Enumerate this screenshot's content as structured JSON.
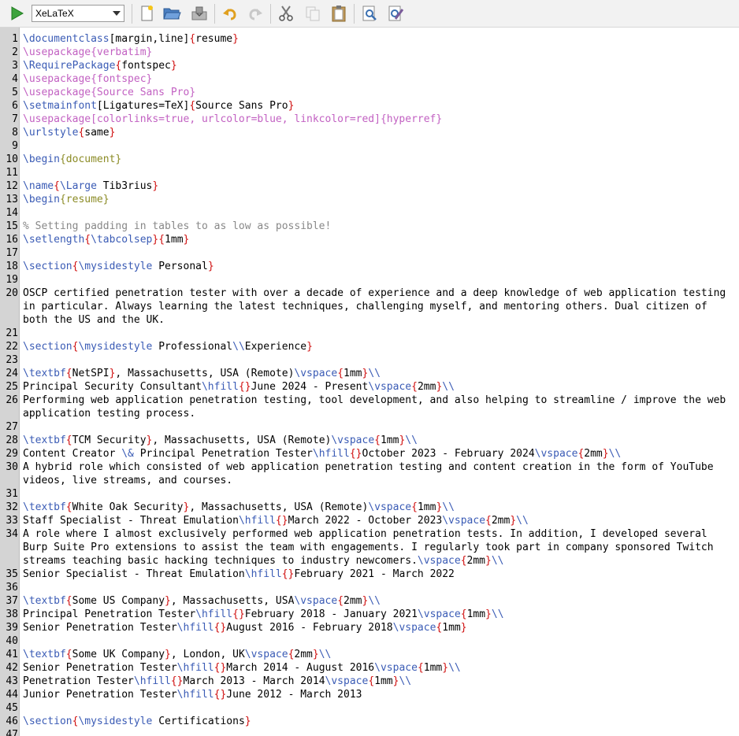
{
  "toolbar": {
    "compiler": "XeLaTeX",
    "buttons": [
      {
        "name": "compile-button",
        "icon": "play-icon"
      },
      {
        "name": "new-file-button",
        "icon": "new-document-icon"
      },
      {
        "name": "open-file-button",
        "icon": "folder-open-icon"
      },
      {
        "name": "save-button",
        "icon": "save-icon"
      },
      {
        "name": "undo-button",
        "icon": "undo-icon"
      },
      {
        "name": "redo-button",
        "icon": "redo-icon"
      },
      {
        "name": "cut-button",
        "icon": "scissors-icon"
      },
      {
        "name": "copy-button",
        "icon": "copy-icon"
      },
      {
        "name": "paste-button",
        "icon": "clipboard-icon"
      },
      {
        "name": "find-button",
        "icon": "find-icon"
      },
      {
        "name": "replace-button",
        "icon": "replace-icon"
      }
    ]
  },
  "colors": {
    "command": "#3a5bb5",
    "brace": "#d01010",
    "argument": "#8b8b25",
    "package": "#c261c2",
    "comment": "#888888"
  },
  "lines": [
    {
      "n": "1",
      "t": [
        [
          "cmd",
          "\\documentclass"
        ],
        [
          "opt",
          "[margin,line]"
        ],
        [
          "br",
          "{"
        ],
        [
          "opt",
          "resume"
        ],
        [
          "br",
          "}"
        ]
      ]
    },
    {
      "n": "2",
      "t": [
        [
          "pkg",
          "\\usepackage{verbatim}"
        ]
      ]
    },
    {
      "n": "3",
      "t": [
        [
          "cmd",
          "\\RequirePackage"
        ],
        [
          "br",
          "{"
        ],
        [
          "opt",
          "fontspec"
        ],
        [
          "br",
          "}"
        ]
      ]
    },
    {
      "n": "4",
      "t": [
        [
          "pkg",
          "\\usepackage{fontspec}"
        ]
      ]
    },
    {
      "n": "5",
      "t": [
        [
          "pkg",
          "\\usepackage{Source Sans Pro}"
        ]
      ]
    },
    {
      "n": "6",
      "t": [
        [
          "cmd",
          "\\setmainfont"
        ],
        [
          "opt",
          "[Ligatures=TeX]"
        ],
        [
          "br",
          "{"
        ],
        [
          "opt",
          "Source Sans Pro"
        ],
        [
          "br",
          "}"
        ]
      ]
    },
    {
      "n": "7",
      "t": [
        [
          "pkg",
          "\\usepackage[colorlinks=true, urlcolor=blue, linkcolor=red]{hyperref}"
        ]
      ]
    },
    {
      "n": "8",
      "t": [
        [
          "cmd",
          "\\urlstyle"
        ],
        [
          "br",
          "{"
        ],
        [
          "opt",
          "same"
        ],
        [
          "br",
          "}"
        ]
      ]
    },
    {
      "n": "9",
      "t": []
    },
    {
      "n": "10",
      "t": [
        [
          "cmd",
          "\\begin"
        ],
        [
          "arg",
          "{document}"
        ]
      ]
    },
    {
      "n": "11",
      "t": []
    },
    {
      "n": "12",
      "t": [
        [
          "cmd",
          "\\name"
        ],
        [
          "br",
          "{"
        ],
        [
          "cmd",
          "\\Large"
        ],
        [
          "opt",
          " Tib3rius"
        ],
        [
          "br",
          "}"
        ]
      ]
    },
    {
      "n": "13",
      "t": [
        [
          "cmd",
          "\\begin"
        ],
        [
          "arg",
          "{resume}"
        ]
      ]
    },
    {
      "n": "14",
      "t": []
    },
    {
      "n": "15",
      "t": [
        [
          "cm",
          "% Setting padding in tables to as low as possible!"
        ]
      ]
    },
    {
      "n": "16",
      "t": [
        [
          "cmd",
          "\\setlength"
        ],
        [
          "br",
          "{"
        ],
        [
          "cmd",
          "\\tabcolsep"
        ],
        [
          "br",
          "}{"
        ],
        [
          "opt",
          "1mm"
        ],
        [
          "br",
          "}"
        ]
      ]
    },
    {
      "n": "17",
      "t": []
    },
    {
      "n": "18",
      "t": [
        [
          "cmd",
          "\\section"
        ],
        [
          "br",
          "{"
        ],
        [
          "cmd",
          "\\mysidestyle"
        ],
        [
          "opt",
          " Personal"
        ],
        [
          "br",
          "}"
        ]
      ]
    },
    {
      "n": "19",
      "t": []
    },
    {
      "n": "20",
      "t": [
        [
          "opt",
          "OSCP certified penetration tester with over a decade of experience and a deep knowledge of web application testing in particular. Always learning the latest techniques, challenging myself, and mentoring others. Dual citizen of both the US and the UK."
        ]
      ]
    },
    {
      "n": "21",
      "t": []
    },
    {
      "n": "22",
      "t": [
        [
          "cmd",
          "\\section"
        ],
        [
          "br",
          "{"
        ],
        [
          "cmd",
          "\\mysidestyle"
        ],
        [
          "opt",
          " Professional"
        ],
        [
          "cmd",
          "\\\\"
        ],
        [
          "opt",
          "Experience"
        ],
        [
          "br",
          "}"
        ]
      ]
    },
    {
      "n": "23",
      "t": []
    },
    {
      "n": "24",
      "t": [
        [
          "cmd",
          "\\textbf"
        ],
        [
          "br",
          "{"
        ],
        [
          "opt",
          "NetSPI"
        ],
        [
          "br",
          "}"
        ],
        [
          "opt",
          ", Massachusetts, USA (Remote)"
        ],
        [
          "cmd",
          "\\vspace"
        ],
        [
          "br",
          "{"
        ],
        [
          "opt",
          "1mm"
        ],
        [
          "br",
          "}"
        ],
        [
          "cmd",
          "\\\\"
        ]
      ]
    },
    {
      "n": "25",
      "t": [
        [
          "opt",
          "Principal Security Consultant"
        ],
        [
          "cmd",
          "\\hfill"
        ],
        [
          "br",
          "{}"
        ],
        [
          "opt",
          "June 2024 - Present"
        ],
        [
          "cmd",
          "\\vspace"
        ],
        [
          "br",
          "{"
        ],
        [
          "opt",
          "2mm"
        ],
        [
          "br",
          "}"
        ],
        [
          "cmd",
          "\\\\"
        ]
      ]
    },
    {
      "n": "26",
      "t": [
        [
          "opt",
          "Performing web application penetration testing, tool development, and also helping to streamline / improve the web application testing process."
        ]
      ]
    },
    {
      "n": "27",
      "t": []
    },
    {
      "n": "28",
      "t": [
        [
          "cmd",
          "\\textbf"
        ],
        [
          "br",
          "{"
        ],
        [
          "opt",
          "TCM Security"
        ],
        [
          "br",
          "}"
        ],
        [
          "opt",
          ", Massachusetts, USA (Remote)"
        ],
        [
          "cmd",
          "\\vspace"
        ],
        [
          "br",
          "{"
        ],
        [
          "opt",
          "1mm"
        ],
        [
          "br",
          "}"
        ],
        [
          "cmd",
          "\\\\"
        ]
      ]
    },
    {
      "n": "29",
      "t": [
        [
          "opt",
          "Content Creator "
        ],
        [
          "cmd",
          "\\&"
        ],
        [
          "opt",
          " Principal Penetration Tester"
        ],
        [
          "cmd",
          "\\hfill"
        ],
        [
          "br",
          "{}"
        ],
        [
          "opt",
          "October 2023 - February 2024"
        ],
        [
          "cmd",
          "\\vspace"
        ],
        [
          "br",
          "{"
        ],
        [
          "opt",
          "2mm"
        ],
        [
          "br",
          "}"
        ],
        [
          "cmd",
          "\\\\"
        ]
      ]
    },
    {
      "n": "30",
      "t": [
        [
          "opt",
          "A hybrid role which consisted of web application penetration testing and content creation in the form of YouTube videos, live streams, and courses."
        ]
      ]
    },
    {
      "n": "31",
      "t": []
    },
    {
      "n": "32",
      "t": [
        [
          "cmd",
          "\\textbf"
        ],
        [
          "br",
          "{"
        ],
        [
          "opt",
          "White Oak Security"
        ],
        [
          "br",
          "}"
        ],
        [
          "opt",
          ", Massachusetts, USA (Remote)"
        ],
        [
          "cmd",
          "\\vspace"
        ],
        [
          "br",
          "{"
        ],
        [
          "opt",
          "1mm"
        ],
        [
          "br",
          "}"
        ],
        [
          "cmd",
          "\\\\"
        ]
      ]
    },
    {
      "n": "33",
      "t": [
        [
          "opt",
          "Staff Specialist - Threat Emulation"
        ],
        [
          "cmd",
          "\\hfill"
        ],
        [
          "br",
          "{}"
        ],
        [
          "opt",
          "March 2022 - October 2023"
        ],
        [
          "cmd",
          "\\vspace"
        ],
        [
          "br",
          "{"
        ],
        [
          "opt",
          "2mm"
        ],
        [
          "br",
          "}"
        ],
        [
          "cmd",
          "\\\\"
        ]
      ]
    },
    {
      "n": "34",
      "t": [
        [
          "opt",
          "A role where I almost exclusively performed web application penetration tests. In addition, I developed several Burp Suite Pro extensions to assist the team with engagements. I regularly took part in company sponsored Twitch streams teaching basic hacking techniques to industry newcomers."
        ],
        [
          "cmd",
          "\\vspace"
        ],
        [
          "br",
          "{"
        ],
        [
          "opt",
          "2mm"
        ],
        [
          "br",
          "}"
        ],
        [
          "cmd",
          "\\\\"
        ]
      ]
    },
    {
      "n": "35",
      "t": [
        [
          "opt",
          "Senior Specialist - Threat Emulation"
        ],
        [
          "cmd",
          "\\hfill"
        ],
        [
          "br",
          "{}"
        ],
        [
          "opt",
          "February 2021 - March 2022"
        ]
      ]
    },
    {
      "n": "36",
      "t": []
    },
    {
      "n": "37",
      "t": [
        [
          "cmd",
          "\\textbf"
        ],
        [
          "br",
          "{"
        ],
        [
          "opt",
          "Some US Company"
        ],
        [
          "br",
          "}"
        ],
        [
          "opt",
          ", Massachusetts, USA"
        ],
        [
          "cmd",
          "\\vspace"
        ],
        [
          "br",
          "{"
        ],
        [
          "opt",
          "2mm"
        ],
        [
          "br",
          "}"
        ],
        [
          "cmd",
          "\\\\"
        ]
      ]
    },
    {
      "n": "38",
      "t": [
        [
          "opt",
          "Principal Penetration Tester"
        ],
        [
          "cmd",
          "\\hfill"
        ],
        [
          "br",
          "{}"
        ],
        [
          "opt",
          "February 2018 - January 2021"
        ],
        [
          "cmd",
          "\\vspace"
        ],
        [
          "br",
          "{"
        ],
        [
          "opt",
          "1mm"
        ],
        [
          "br",
          "}"
        ],
        [
          "cmd",
          "\\\\"
        ]
      ]
    },
    {
      "n": "39",
      "t": [
        [
          "opt",
          "Senior Penetration Tester"
        ],
        [
          "cmd",
          "\\hfill"
        ],
        [
          "br",
          "{}"
        ],
        [
          "opt",
          "August 2016 - February 2018"
        ],
        [
          "cmd",
          "\\vspace"
        ],
        [
          "br",
          "{"
        ],
        [
          "opt",
          "1mm"
        ],
        [
          "br",
          "}"
        ]
      ]
    },
    {
      "n": "40",
      "t": []
    },
    {
      "n": "41",
      "t": [
        [
          "cmd",
          "\\textbf"
        ],
        [
          "br",
          "{"
        ],
        [
          "opt",
          "Some UK Company"
        ],
        [
          "br",
          "}"
        ],
        [
          "opt",
          ", London, UK"
        ],
        [
          "cmd",
          "\\vspace"
        ],
        [
          "br",
          "{"
        ],
        [
          "opt",
          "2mm"
        ],
        [
          "br",
          "}"
        ],
        [
          "cmd",
          "\\\\"
        ]
      ]
    },
    {
      "n": "42",
      "t": [
        [
          "opt",
          "Senior Penetration Tester"
        ],
        [
          "cmd",
          "\\hfill"
        ],
        [
          "br",
          "{}"
        ],
        [
          "opt",
          "March 2014 - August 2016"
        ],
        [
          "cmd",
          "\\vspace"
        ],
        [
          "br",
          "{"
        ],
        [
          "opt",
          "1mm"
        ],
        [
          "br",
          "}"
        ],
        [
          "cmd",
          "\\\\"
        ]
      ]
    },
    {
      "n": "43",
      "t": [
        [
          "opt",
          "Penetration Tester"
        ],
        [
          "cmd",
          "\\hfill"
        ],
        [
          "br",
          "{}"
        ],
        [
          "opt",
          "March 2013 - March 2014"
        ],
        [
          "cmd",
          "\\vspace"
        ],
        [
          "br",
          "{"
        ],
        [
          "opt",
          "1mm"
        ],
        [
          "br",
          "}"
        ],
        [
          "cmd",
          "\\\\"
        ]
      ]
    },
    {
      "n": "44",
      "t": [
        [
          "opt",
          "Junior Penetration Tester"
        ],
        [
          "cmd",
          "\\hfill"
        ],
        [
          "br",
          "{}"
        ],
        [
          "opt",
          "June 2012 - March 2013"
        ]
      ]
    },
    {
      "n": "45",
      "t": []
    },
    {
      "n": "46",
      "t": [
        [
          "cmd",
          "\\section"
        ],
        [
          "br",
          "{"
        ],
        [
          "cmd",
          "\\mysidestyle"
        ],
        [
          "opt",
          " Certifications"
        ],
        [
          "br",
          "}"
        ]
      ]
    },
    {
      "n": "47",
      "t": []
    }
  ]
}
